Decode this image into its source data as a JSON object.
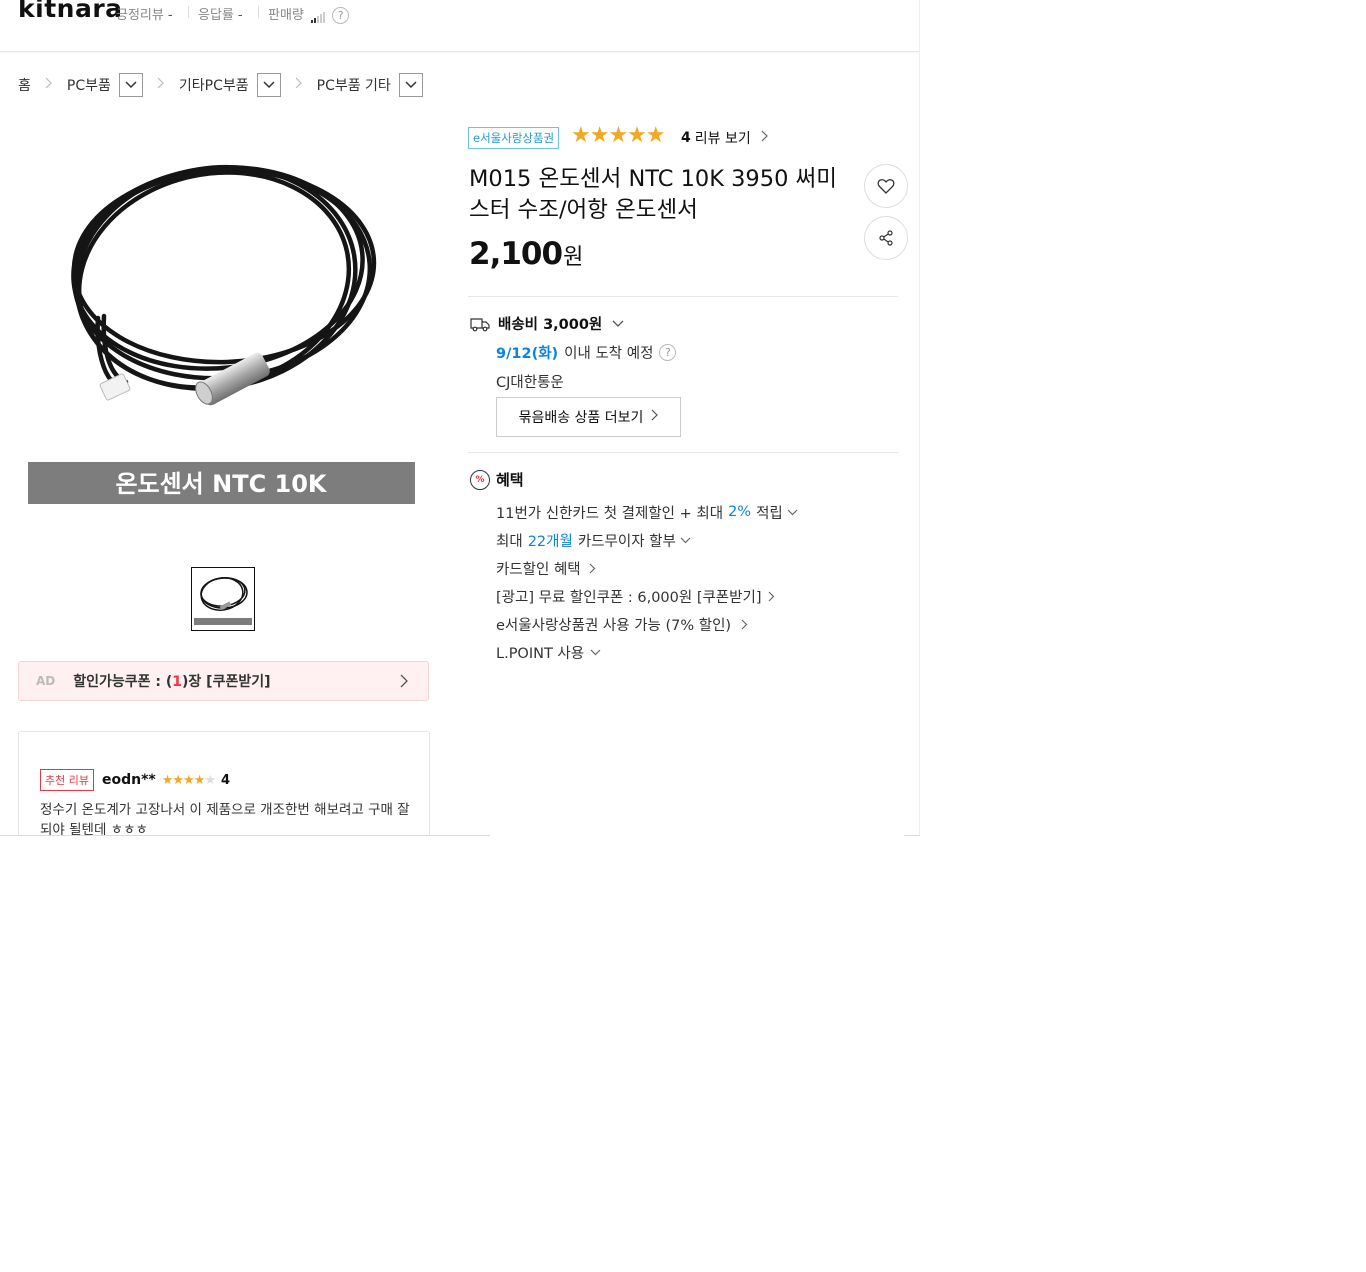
{
  "seller": {
    "name": "kitnara",
    "stat1_label": "긍정리뷰",
    "stat1_value": "-",
    "stat2_label": "응답률",
    "stat2_value": "-",
    "stat3_label": "판매량",
    "help": "?"
  },
  "breadcrumb": {
    "home": "홈",
    "level1": "PC부품",
    "level2": "기타PC부품",
    "level3": "PC부품 기타"
  },
  "product": {
    "image_caption": "온도센서 NTC 10K",
    "gift_badge": "e서울사랑상품권",
    "rating_stars": 5,
    "review_count": "4",
    "review_link_label": "리뷰 보기",
    "title": "M015 온도센서 NTC 10K 3950 써미스터 수조/어항 온도센서",
    "price": "2,100",
    "price_unit": "원"
  },
  "coupon": {
    "ad_tag": "AD",
    "prefix": "할인가능쿠폰 : (",
    "count": "1",
    "suffix": ")장 [쿠폰받기]"
  },
  "review": {
    "badge": "추천 리뷰",
    "user": "eodn**",
    "rating": 4,
    "score": "4",
    "body": "정수기 온도계가 고장나서 이 제품으로 개조한번 해보려고 구매 잘되야 될텐데 ㅎㅎㅎ"
  },
  "shipping": {
    "fee_label": "배송비 3,000원",
    "arrive_date": "9/12(화)",
    "arrive_text": "이내 도착 예정",
    "carrier": "CJ대한통운",
    "bundle_button": "묶음배송 상품 더보기"
  },
  "benefits": {
    "title": "혜택",
    "item1_pre": "11번가 신한카드 첫 결제할인 + 최대",
    "item1_hl": "2%",
    "item1_post": "적립",
    "item2_pre": "최대",
    "item2_hl": "22개월",
    "item2_post": "카드무이자 할부",
    "item3": "카드할인 혜택",
    "item4": "[광고] 무료 할인쿠폰 : 6,000원 [쿠폰받기]",
    "item5": "e서울사랑상품권 사용 가능 (7% 할인)",
    "item6": "L.POINT 사용"
  },
  "colors": {
    "accent_blue": "#0b83e6",
    "star": "#f5a623",
    "coupon_red": "#f43142"
  }
}
